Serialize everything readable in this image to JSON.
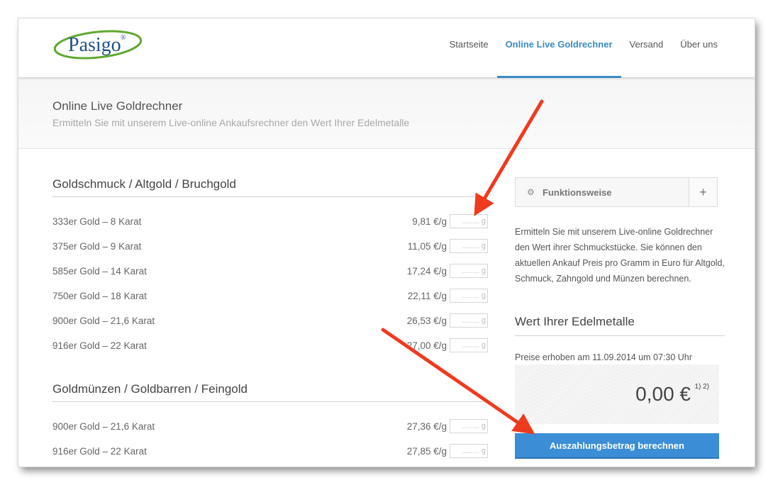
{
  "header": {
    "logo_text": "Pasigo",
    "logo_mark": "®",
    "nav": [
      {
        "label": "Startseite",
        "active": false
      },
      {
        "label": "Online Live Goldrechner",
        "active": true
      },
      {
        "label": "Versand",
        "active": false
      },
      {
        "label": "Über uns",
        "active": false
      }
    ]
  },
  "band": {
    "title": "Online Live Goldrechner",
    "subtitle": "Ermitteln Sie mit unserem Live-online Ankaufsrechner den Wert Ihrer Edelmetalle"
  },
  "sections": [
    {
      "title": "Goldschmuck / Altgold / Bruchgold",
      "rows": [
        {
          "label": "333er Gold – 8 Karat",
          "price": "9,81 €/g",
          "placeholder": "........ g"
        },
        {
          "label": "375er Gold – 9 Karat",
          "price": "11,05 €/g",
          "placeholder": "........ g"
        },
        {
          "label": "585er Gold – 14 Karat",
          "price": "17,24 €/g",
          "placeholder": "........ g"
        },
        {
          "label": "750er Gold – 18 Karat",
          "price": "22,11 €/g",
          "placeholder": "........ g"
        },
        {
          "label": "900er Gold – 21,6 Karat",
          "price": "26,53 €/g",
          "placeholder": "........ g"
        },
        {
          "label": "916er Gold – 22 Karat",
          "price": "27,00 €/g",
          "placeholder": "........ g"
        }
      ]
    },
    {
      "title": "Goldmünzen / Goldbarren / Feingold",
      "rows": [
        {
          "label": "900er Gold – 21,6 Karat",
          "price": "27,36 €/g",
          "placeholder": "........ g"
        },
        {
          "label": "916er Gold – 22 Karat",
          "price": "27,85 €/g",
          "placeholder": "........ g"
        }
      ]
    }
  ],
  "sidebar": {
    "accordion_label": "Funktionsweise",
    "accordion_icon": "gear-icon",
    "accordion_toggle": "+",
    "info_text": "Ermitteln Sie mit unserem Live-online Goldrechner den Wert ihrer Schmuckstücke. Sie können den aktuellen Ankauf Preis pro Gramm in Euro für Altgold, Schmuck, Zahngold und Münzen berechnen.",
    "value_title": "Wert Ihrer Edelmetalle",
    "price_date": "Preise erhoben am 11.09.2014 um 07:30 Uhr",
    "result_amount": "0,00 €",
    "result_footnote": "1) 2)",
    "calc_button": "Auszahlungsbetrag berechnen"
  },
  "colors": {
    "accent": "#3a8bc6",
    "button": "#3b8ed6",
    "annotation_arrow": "#f03a1e",
    "logo_green": "#5fa82f",
    "logo_blue": "#1f4f8b"
  }
}
